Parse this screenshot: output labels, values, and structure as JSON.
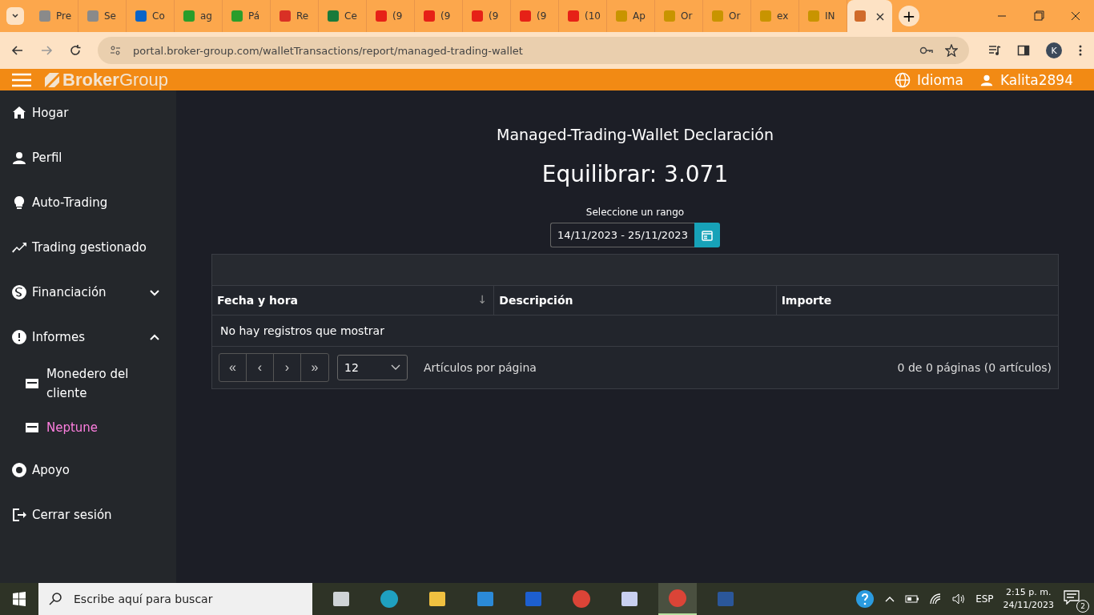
{
  "browser": {
    "tabs": [
      {
        "title": "Pre",
        "kind": "globe",
        "selected": false
      },
      {
        "title": "Se",
        "kind": "globe",
        "selected": false
      },
      {
        "title": "Co",
        "kind": "mail",
        "selected": false
      },
      {
        "title": "ag",
        "kind": "tree",
        "selected": false
      },
      {
        "title": "Pá",
        "kind": "tree",
        "selected": false
      },
      {
        "title": "Re",
        "kind": "letter",
        "selected": false
      },
      {
        "title": "Ce",
        "kind": "square",
        "selected": false
      },
      {
        "title": "(9",
        "kind": "play",
        "selected": false
      },
      {
        "title": "(9",
        "kind": "play",
        "selected": false
      },
      {
        "title": "(9",
        "kind": "play",
        "selected": false
      },
      {
        "title": "(9",
        "kind": "play",
        "selected": false
      },
      {
        "title": "(10",
        "kind": "play",
        "selected": false
      },
      {
        "title": "Ap",
        "kind": "coin",
        "selected": false
      },
      {
        "title": "Or",
        "kind": "coin",
        "selected": false
      },
      {
        "title": "Or",
        "kind": "coin",
        "selected": false
      },
      {
        "title": "ex",
        "kind": "coin",
        "selected": false
      },
      {
        "title": "IN",
        "kind": "coin",
        "selected": false
      },
      {
        "kind": "chart",
        "selected": true
      }
    ],
    "close_tab": "×",
    "new_tab": "+",
    "url": "portal.broker-group.com/walletTransactions/report/managed-trading-wallet",
    "profile_initial": "K"
  },
  "header": {
    "logo_bold": "Broker",
    "logo_light": "Group",
    "language": "Idioma",
    "user": "Kalita2894"
  },
  "sidebar": {
    "items": [
      {
        "label": "Hogar",
        "kind": "home",
        "selected": false
      },
      {
        "label": "Perfil",
        "kind": "person",
        "selected": false
      },
      {
        "label": "Auto-Trading",
        "kind": "bulb",
        "selected": false
      },
      {
        "label": "Trading gestionado",
        "kind": "trend",
        "selected": false
      },
      {
        "label": "Financiación",
        "kind": "dollar",
        "selected": false,
        "expanded": false
      },
      {
        "label": "Informes",
        "kind": "alert",
        "selected": false,
        "expanded": true,
        "children": [
          {
            "label": "Monedero del cliente",
            "kind": "wallet",
            "selected": false
          },
          {
            "label": "Neptune",
            "kind": "wallet",
            "selected": true
          }
        ]
      },
      {
        "label": "Apoyo",
        "kind": "lifebuoy",
        "selected": false
      },
      {
        "label": "Cerrar sesión",
        "kind": "logout",
        "selected": false
      }
    ]
  },
  "main": {
    "title": "Managed-Trading-Wallet Declaración",
    "balance": "Equilibrar: 3.071",
    "range_label": "Seleccione un rango",
    "range_value": "14/11/2023 - 25/11/2023",
    "table": {
      "columns": [
        "Fecha y hora",
        "Descripción",
        "Importe"
      ],
      "sort_icon": "↓",
      "empty": "No hay registros que mostrar"
    },
    "pager": {
      "buttons": [
        "«",
        "‹",
        "›",
        "»"
      ],
      "page_size": "12",
      "page_size_label": "Artículos por página",
      "summary": "0 de 0 páginas (0 artículos)"
    }
  },
  "taskbar": {
    "search_placeholder": "Escribe aquí para buscar",
    "apps": [
      {
        "kind": "taskview",
        "selected": false
      },
      {
        "kind": "edge",
        "selected": false
      },
      {
        "kind": "folder",
        "selected": false
      },
      {
        "kind": "mail",
        "selected": false
      },
      {
        "kind": "whiteboard",
        "selected": false
      },
      {
        "kind": "chrome",
        "selected": false
      },
      {
        "kind": "moon",
        "selected": false
      },
      {
        "kind": "chrome",
        "selected": true
      },
      {
        "kind": "word",
        "selected": false
      }
    ],
    "language": "ESP",
    "time": "2:15 p. m.",
    "date": "24/11/2023",
    "notifications": "2"
  }
}
